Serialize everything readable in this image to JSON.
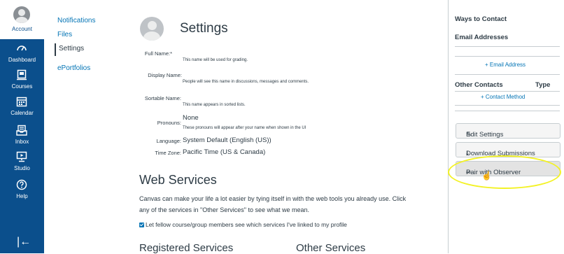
{
  "global_nav": {
    "items": [
      {
        "label": "Account",
        "icon": "account-icon"
      },
      {
        "label": "Dashboard",
        "icon": "dashboard-icon"
      },
      {
        "label": "Courses",
        "icon": "courses-icon"
      },
      {
        "label": "Calendar",
        "icon": "calendar-icon"
      },
      {
        "label": "Inbox",
        "icon": "inbox-icon"
      },
      {
        "label": "Studio",
        "icon": "studio-icon"
      },
      {
        "label": "Help",
        "icon": "help-icon"
      }
    ],
    "collapse_glyph": "|←"
  },
  "subnav": {
    "items": [
      "Notifications",
      "Files",
      "Settings",
      "ePortfolios"
    ]
  },
  "main": {
    "title": "Settings",
    "fields": [
      {
        "label": "Full Name:*",
        "value": "",
        "hint": "This name will be used for grading."
      },
      {
        "label": "Display Name:",
        "value": "",
        "hint": "People will see this name in discussions, messages and comments."
      },
      {
        "label": "Sortable Name:",
        "value": "",
        "hint": "This name appears in sorted lists."
      },
      {
        "label": "Pronouns:",
        "value": "None",
        "hint": "These pronouns will appear after your name when shown in the UI"
      },
      {
        "label": "Language:",
        "value": "System Default (English (US))"
      },
      {
        "label": "Time Zone:",
        "value": "Pacific Time (US & Canada)"
      }
    ],
    "web_services": {
      "title": "Web Services",
      "paragraph_line1": "Canvas can make your life a lot easier by tying itself in with the web tools you already use. Click",
      "paragraph_line2": "any of the services in \"Other Services\" to see what we mean.",
      "checkbox_label": "Let fellow course/group members see which services I've linked to my profile",
      "registered": "Registered Services",
      "other": "Other Services"
    }
  },
  "sidebar": {
    "ways_to_contact": "Ways to Contact",
    "email_addresses": "Email Addresses",
    "add_email": "Email Address",
    "other_contacts": "Other Contacts",
    "type": "Type",
    "add_contact": "Contact Method",
    "buttons": {
      "edit": "Edit Settings",
      "download": "Download Submissions",
      "pair": "Pair with Observer"
    }
  },
  "colors": {
    "nav_bg": "#0b4f8c",
    "link": "#0374b5",
    "highlight": "#f3f224"
  }
}
